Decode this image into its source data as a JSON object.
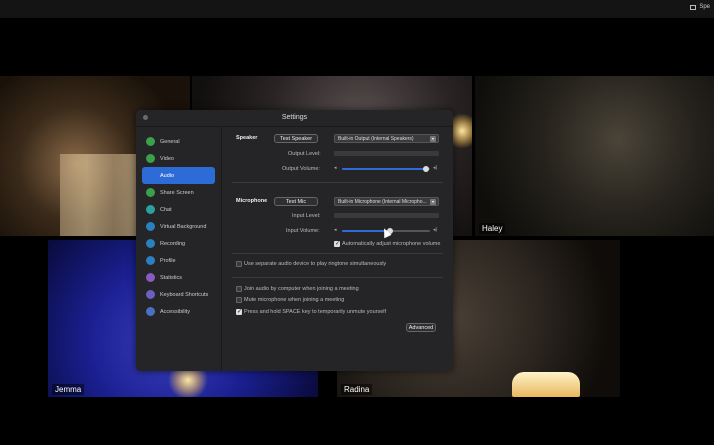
{
  "top_bar": {
    "view_label": "Spe"
  },
  "participants": [
    {
      "id": "t1",
      "name": ""
    },
    {
      "id": "t2",
      "name": ""
    },
    {
      "id": "t3",
      "name": "Haley"
    },
    {
      "id": "t4",
      "name": "Jemma"
    },
    {
      "id": "t5",
      "name": "Radina"
    }
  ],
  "settings": {
    "title": "Settings",
    "nav": [
      {
        "label": "General",
        "icon": "gear-icon",
        "color": "#3aa04a"
      },
      {
        "label": "Video",
        "icon": "video-icon",
        "color": "#3aa04a"
      },
      {
        "label": "Audio",
        "icon": "headphones-icon",
        "color": "#2d6cd6",
        "active": true
      },
      {
        "label": "Share Screen",
        "icon": "share-screen-icon",
        "color": "#3aa04a"
      },
      {
        "label": "Chat",
        "icon": "chat-icon",
        "color": "#2aa0a0"
      },
      {
        "label": "Virtual Background",
        "icon": "background-icon",
        "color": "#2a80c0"
      },
      {
        "label": "Recording",
        "icon": "recording-icon",
        "color": "#2a80c0"
      },
      {
        "label": "Profile",
        "icon": "profile-icon",
        "color": "#2a80c0"
      },
      {
        "label": "Statistics",
        "icon": "statistics-icon",
        "color": "#8a5ac0"
      },
      {
        "label": "Keyboard Shortcuts",
        "icon": "keyboard-icon",
        "color": "#6a60c0"
      },
      {
        "label": "Accessibility",
        "icon": "accessibility-icon",
        "color": "#4a70c0"
      }
    ],
    "speaker": {
      "label": "Speaker",
      "test_button": "Test Speaker",
      "device": "Built-in Output (Internal Speakers)",
      "output_level_label": "Output Level:",
      "output_volume_label": "Output Volume:",
      "output_volume": 0.95
    },
    "microphone": {
      "label": "Microphone",
      "test_button": "Test Mic",
      "device": "Built-in Microphone (Internal Micropho...",
      "input_level_label": "Input Level:",
      "input_volume_label": "Input Volume:",
      "input_volume": 0.55,
      "auto_adjust_label": "Automatically adjust microphone volume",
      "auto_adjust": true
    },
    "options": [
      {
        "label": "Use separate audio device to play ringtone simultaneously",
        "checked": false
      },
      {
        "label": "Join audio by computer when joining a meeting",
        "checked": false
      },
      {
        "label": "Mute microphone when joining a meeting",
        "checked": false
      },
      {
        "label": "Press and hold SPACE key to temporarily unmute yourself",
        "checked": true
      }
    ],
    "advanced_button": "Advanced"
  }
}
